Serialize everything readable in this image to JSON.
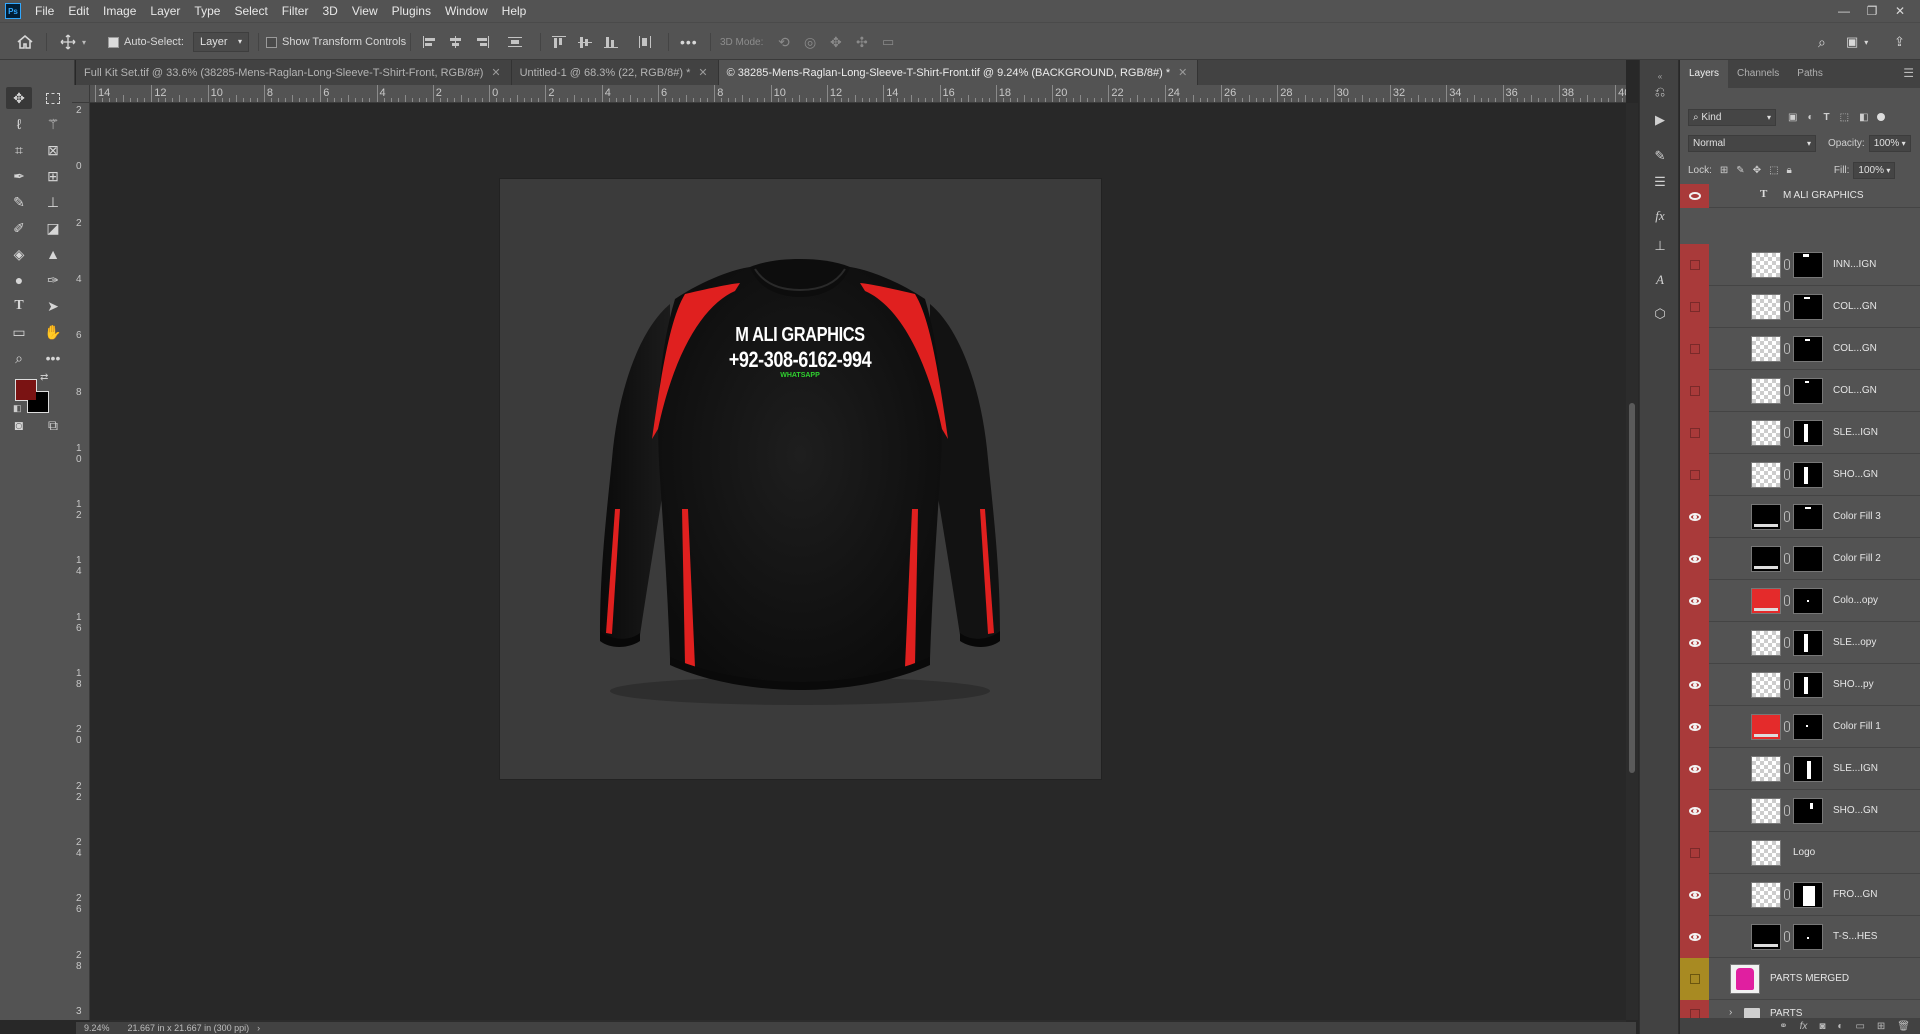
{
  "menubar": {
    "logo": "Ps",
    "items": [
      "File",
      "Edit",
      "Image",
      "Layer",
      "Type",
      "Select",
      "Filter",
      "3D",
      "View",
      "Plugins",
      "Window",
      "Help"
    ]
  },
  "options": {
    "auto_select_label": "Auto-Select:",
    "auto_select_value": "Layer",
    "show_transform_label": "Show Transform Controls",
    "mode_3d_label": "3D Mode:",
    "more": "•••"
  },
  "tabs": [
    {
      "label": "Full Kit Set.tif @ 33.6% (38285-Mens-Raglan-Long-Sleeve-T-Shirt-Front, RGB/8#)",
      "active": false
    },
    {
      "label": "Untitled-1 @ 68.3% (22, RGB/8#) *",
      "active": false
    },
    {
      "label": "© 38285-Mens-Raglan-Long-Sleeve-T-Shirt-Front.tif @ 9.24% (BACKGROUND, RGB/8#) *",
      "active": true
    }
  ],
  "ruler": {
    "h_labels": [
      "14",
      "12",
      "10",
      "8",
      "6",
      "4",
      "2",
      "0",
      "2",
      "4",
      "6",
      "8",
      "10",
      "12",
      "14",
      "16",
      "18",
      "20",
      "22",
      "24",
      "26",
      "28",
      "30",
      "32",
      "34",
      "36",
      "38",
      "40"
    ],
    "v_labels": [
      "2",
      "0",
      "2",
      "4",
      "6",
      "8",
      "10",
      "12",
      "14",
      "16",
      "18",
      "20",
      "22",
      "24",
      "26",
      "28",
      "3"
    ]
  },
  "shirt": {
    "line1": "M ALI GRAPHICS",
    "line2": "+92-308-6162-994",
    "line3": "WHATSAPP",
    "colors": {
      "body": "#161616",
      "stripe": "#e0201f",
      "whatsapp": "#2fd12f"
    }
  },
  "status": {
    "zoom": "9.24%",
    "doc_size": "21.667 in x 21.667 in (300 ppi)"
  },
  "colors": {
    "foreground": "#7a1313",
    "background": "#000000"
  },
  "layers_panel": {
    "tabs": [
      "Layers",
      "Channels",
      "Paths"
    ],
    "kind_label": "Kind",
    "blend_mode": "Normal",
    "opacity_label": "Opacity:",
    "opacity_value": "100%",
    "lock_label": "Lock:",
    "fill_label": "Fill:",
    "fill_value": "100%",
    "top_layer": "M ALI GRAPHICS",
    "layers": [
      {
        "name": "INN...IGN",
        "visible": false
      },
      {
        "name": "COL...GN",
        "visible": false
      },
      {
        "name": "COL...GN",
        "visible": false
      },
      {
        "name": "COL...GN",
        "visible": false
      },
      {
        "name": "SLE...IGN",
        "visible": false
      },
      {
        "name": "SHO...GN",
        "visible": false
      },
      {
        "name": "Color Fill 3",
        "visible": true
      },
      {
        "name": "Color Fill 2",
        "visible": true
      },
      {
        "name": "Colo...opy",
        "visible": true
      },
      {
        "name": "SLE...opy",
        "visible": true
      },
      {
        "name": "SHO...py",
        "visible": true
      },
      {
        "name": "Color Fill 1",
        "visible": true
      },
      {
        "name": "SLE...IGN",
        "visible": true
      },
      {
        "name": "SHO...GN",
        "visible": true
      },
      {
        "name": "Logo",
        "visible": false
      },
      {
        "name": "FRO...GN",
        "visible": true
      },
      {
        "name": "T-S...HES",
        "visible": true
      },
      {
        "name": "PARTS MERGED",
        "visible": false
      },
      {
        "name": "PARTS",
        "visible": false
      }
    ]
  }
}
